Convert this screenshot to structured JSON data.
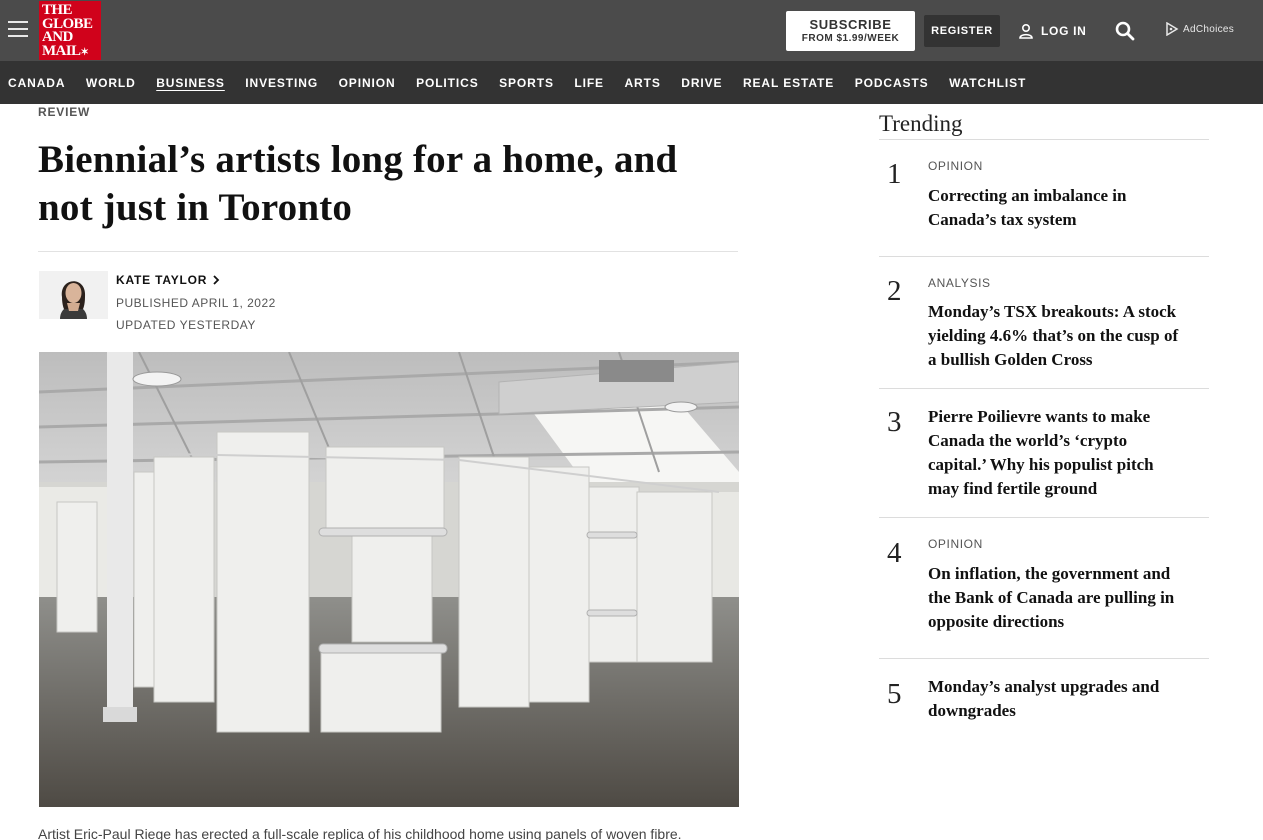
{
  "header": {
    "logo_lines": [
      "THE",
      "GLOBE",
      "AND",
      "MAIL"
    ],
    "subscribe_label": "SUBSCRIBE",
    "subscribe_price": "FROM $1.99/WEEK",
    "register_label": "REGISTER",
    "login_label": "LOG IN",
    "adchoices_label": "AdChoices"
  },
  "nav": {
    "items": [
      "CANADA",
      "WORLD",
      "BUSINESS",
      "INVESTING",
      "OPINION",
      "POLITICS",
      "SPORTS",
      "LIFE",
      "ARTS",
      "DRIVE",
      "REAL ESTATE",
      "PODCASTS",
      "WATCHLIST"
    ],
    "active": "BUSINESS"
  },
  "article": {
    "kicker": "REVIEW",
    "headline_line1": "Biennial’s artists long for a home, and",
    "headline_line2": "not just in Toronto",
    "author": "KATE TAYLOR",
    "published": "PUBLISHED APRIL 1, 2022",
    "updated": "UPDATED YESTERDAY",
    "caption": "Artist Eric-Paul Riege has erected a full-scale replica of his childhood home using panels of woven fibre."
  },
  "trending": {
    "title": "Trending",
    "items": [
      {
        "number": "1",
        "label": "OPINION",
        "lines": [
          "Correcting an imbalance in",
          "Canada’s tax system"
        ]
      },
      {
        "number": "2",
        "label": "ANALYSIS",
        "lines": [
          "Monday’s TSX breakouts: A stock",
          "yielding 4.6% that’s on the cusp of",
          "a bullish Golden Cross"
        ]
      },
      {
        "number": "3",
        "label": "",
        "lines": [
          "Pierre Poilievre wants to make",
          "Canada the world’s ‘crypto",
          "capital.’ Why his populist pitch",
          "may find fertile ground"
        ]
      },
      {
        "number": "4",
        "label": "OPINION",
        "lines": [
          "On inflation, the government and",
          "the Bank of Canada are pulling in",
          "opposite directions"
        ]
      },
      {
        "number": "5",
        "label": "",
        "lines": [
          "Monday’s analyst upgrades and",
          "downgrades"
        ]
      }
    ]
  },
  "colors": {
    "topbar": "#4b4b4b",
    "nav": "#333333",
    "logo": "#d0021b"
  }
}
